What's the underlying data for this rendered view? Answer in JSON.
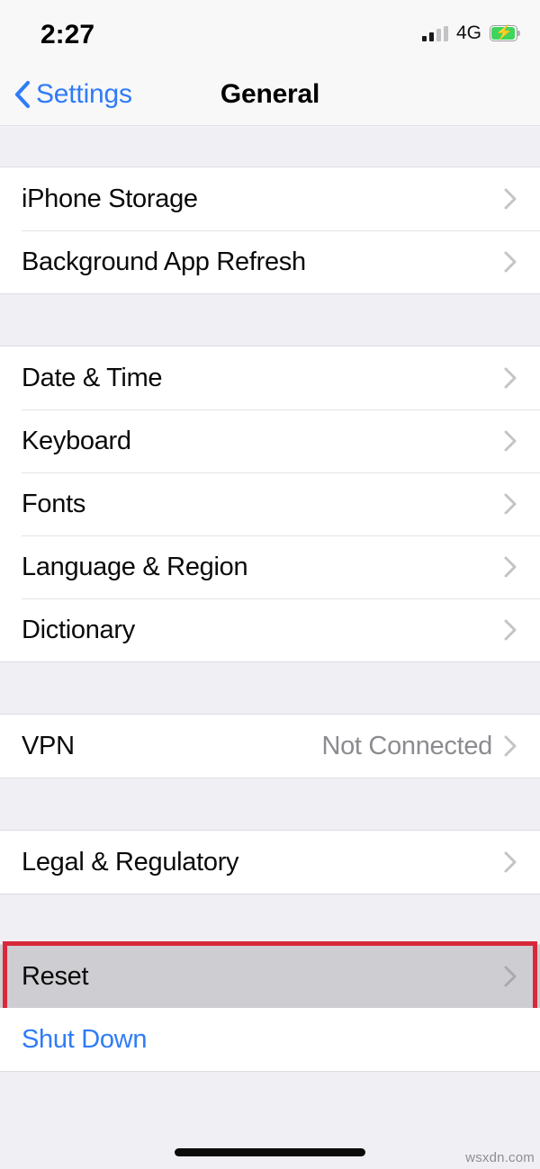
{
  "status_bar": {
    "time": "2:27",
    "network_label": "4G",
    "signal_bars_total": 4,
    "signal_bars_filled": 2,
    "battery_charging": true,
    "battery_color": "#3fd45c"
  },
  "nav_bar": {
    "back_label": "Settings",
    "title": "General",
    "accent_color": "#2f7cf6"
  },
  "groups": [
    {
      "rows": [
        {
          "label": "iPhone Storage",
          "value": "",
          "chevron": true,
          "style": "default"
        },
        {
          "label": "Background App Refresh",
          "value": "",
          "chevron": true,
          "style": "default"
        }
      ]
    },
    {
      "rows": [
        {
          "label": "Date & Time",
          "value": "",
          "chevron": true,
          "style": "default"
        },
        {
          "label": "Keyboard",
          "value": "",
          "chevron": true,
          "style": "default"
        },
        {
          "label": "Fonts",
          "value": "",
          "chevron": true,
          "style": "default"
        },
        {
          "label": "Language & Region",
          "value": "",
          "chevron": true,
          "style": "default"
        },
        {
          "label": "Dictionary",
          "value": "",
          "chevron": true,
          "style": "default"
        }
      ]
    },
    {
      "rows": [
        {
          "label": "VPN",
          "value": "Not Connected",
          "chevron": true,
          "style": "default"
        }
      ]
    },
    {
      "rows": [
        {
          "label": "Legal & Regulatory",
          "value": "",
          "chevron": true,
          "style": "default"
        }
      ]
    },
    {
      "rows": [
        {
          "label": "Reset",
          "value": "",
          "chevron": true,
          "style": "highlighted"
        },
        {
          "label": "Shut Down",
          "value": "",
          "chevron": false,
          "style": "link"
        }
      ]
    }
  ],
  "highlight": {
    "target_label": "Reset",
    "border_color": "#d8293a",
    "fill_color": "#cdcdd2"
  },
  "footer": {
    "watermark": "wsxdn.com"
  }
}
